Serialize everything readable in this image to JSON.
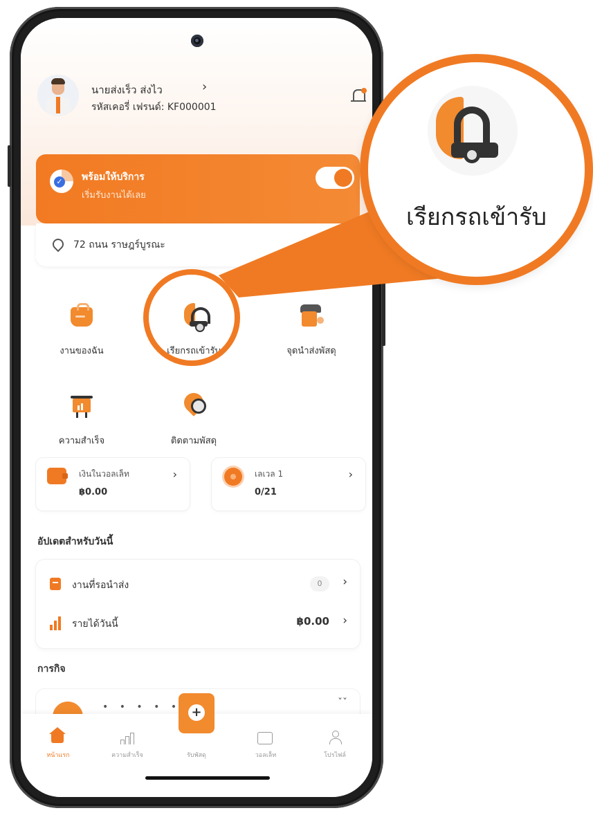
{
  "profile": {
    "name": "นายส่งเร็ว ส่งไว",
    "courier_id": "รหัสเคอรี่ เฟรนด์: KF000001"
  },
  "availability": {
    "title": "พร้อมให้บริการ",
    "subtitle": "เริ่มรับงานได้เลย",
    "online": true
  },
  "address": "72 ถนน ราษฎร์บูรณะ",
  "menu": [
    {
      "label": "งานของฉัน",
      "icon": "job-bag-icon"
    },
    {
      "label": "เรียกรถเข้ารับ",
      "icon": "pickup-truck-icon"
    },
    {
      "label": "จุดนำส่งพัสดุ",
      "icon": "dropoff-point-icon"
    },
    {
      "label": "ความสำเร็จ",
      "icon": "achievement-board-icon"
    },
    {
      "label": "ติดตามพัสดุ",
      "icon": "track-parcel-icon"
    }
  ],
  "wallet": {
    "label": "เงินในวอลเล็ท",
    "value": "฿0.00"
  },
  "level": {
    "label": "เลเวล 1",
    "value": "0/21"
  },
  "updates": {
    "title": "อัปเดตสำหรับวันนี้",
    "pending_label": "งานที่รอนำส่ง",
    "pending_count": "0",
    "income_label": "รายได้วันนี้",
    "income_value": "฿0.00"
  },
  "missions_title": "การกิจ",
  "nav": [
    {
      "label": "หน้าแรก",
      "active": true
    },
    {
      "label": "ความสำเร็จ",
      "active": false
    },
    {
      "label": "รับพัสดุ",
      "active": false
    },
    {
      "label": "วอลเล็ท",
      "active": false
    },
    {
      "label": "โปรไฟล์",
      "active": false
    }
  ],
  "callout": {
    "label": "เรียกรถเข้ารับ"
  },
  "colors": {
    "accent": "#f07a23",
    "accent_light": "#f48a35",
    "frame": "#1e1e1e"
  }
}
